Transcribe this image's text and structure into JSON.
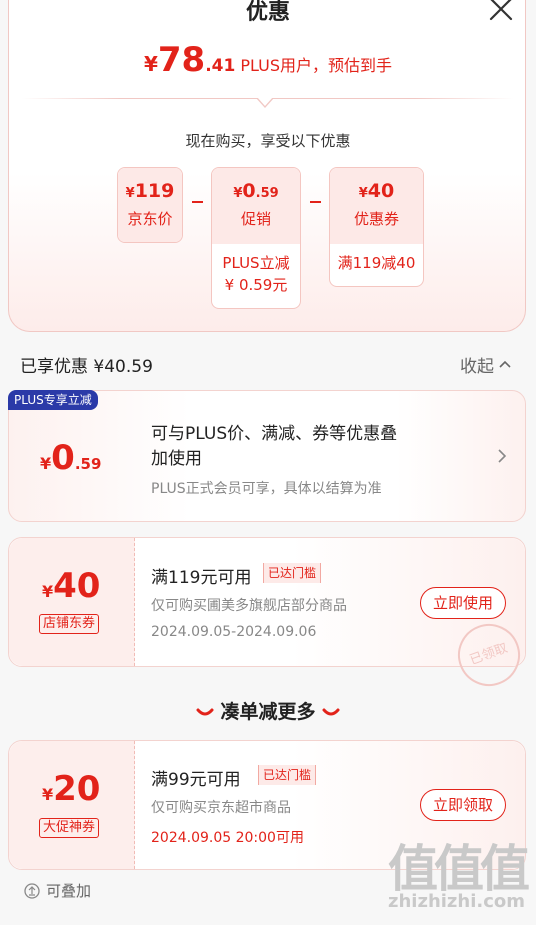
{
  "sheet": {
    "title": "优惠"
  },
  "estimate": {
    "currency": "¥",
    "integer": "78",
    "decimal": ".41",
    "suffix": "PLUS用户，预估到手"
  },
  "breakdown": {
    "subtitle": "现在购买，享受以下优惠",
    "items": [
      {
        "currency": "¥",
        "integer": "119",
        "decimal": "",
        "label": "京东价",
        "footer_lines": []
      },
      {
        "currency": "¥",
        "integer": "0",
        "decimal": ".59",
        "label": "促销",
        "footer_lines": [
          "PLUS立减",
          "¥ 0.59元"
        ]
      },
      {
        "currency": "¥",
        "integer": "40",
        "decimal": "",
        "label": "优惠券",
        "footer_lines": [
          "满119减40"
        ]
      }
    ]
  },
  "section": {
    "enjoyed": "已享优惠 ¥40.59",
    "collapse": "收起"
  },
  "plus_card": {
    "badge": "PLUS专享立减",
    "currency": "¥",
    "integer": "0",
    "decimal": ".59",
    "title_line1": "可与PLUS价、满减、券等优惠叠",
    "title_line2": "加使用",
    "note": "PLUS正式会员可享，具体以结算为准"
  },
  "shop_coupon": {
    "currency": "¥",
    "amount": "40",
    "tag": "店铺东券",
    "title": "满119元可用",
    "reached": "已达门槛",
    "scope": "仅可购买圃美多旗舰店部分商品",
    "validity": "2024.09.05-2024.09.06",
    "action": "立即使用",
    "stamp": "已领取"
  },
  "more": {
    "title": "凑单减更多"
  },
  "promo_coupon": {
    "currency": "¥",
    "amount": "20",
    "tag": "大促神券",
    "title": "满99元可用",
    "reached": "已达门槛",
    "scope": "仅可购买京东超市商品",
    "validity": "2024.09.05 20:00可用",
    "action": "立即领取"
  },
  "footer": {
    "stackable": "可叠加"
  },
  "watermark": {
    "cn": "值值值",
    "en": "zhizhizhi.com"
  },
  "colors": {
    "accent": "#e2231a",
    "tint": "#fde9e7",
    "plus_badge": "#2b3aa8"
  }
}
